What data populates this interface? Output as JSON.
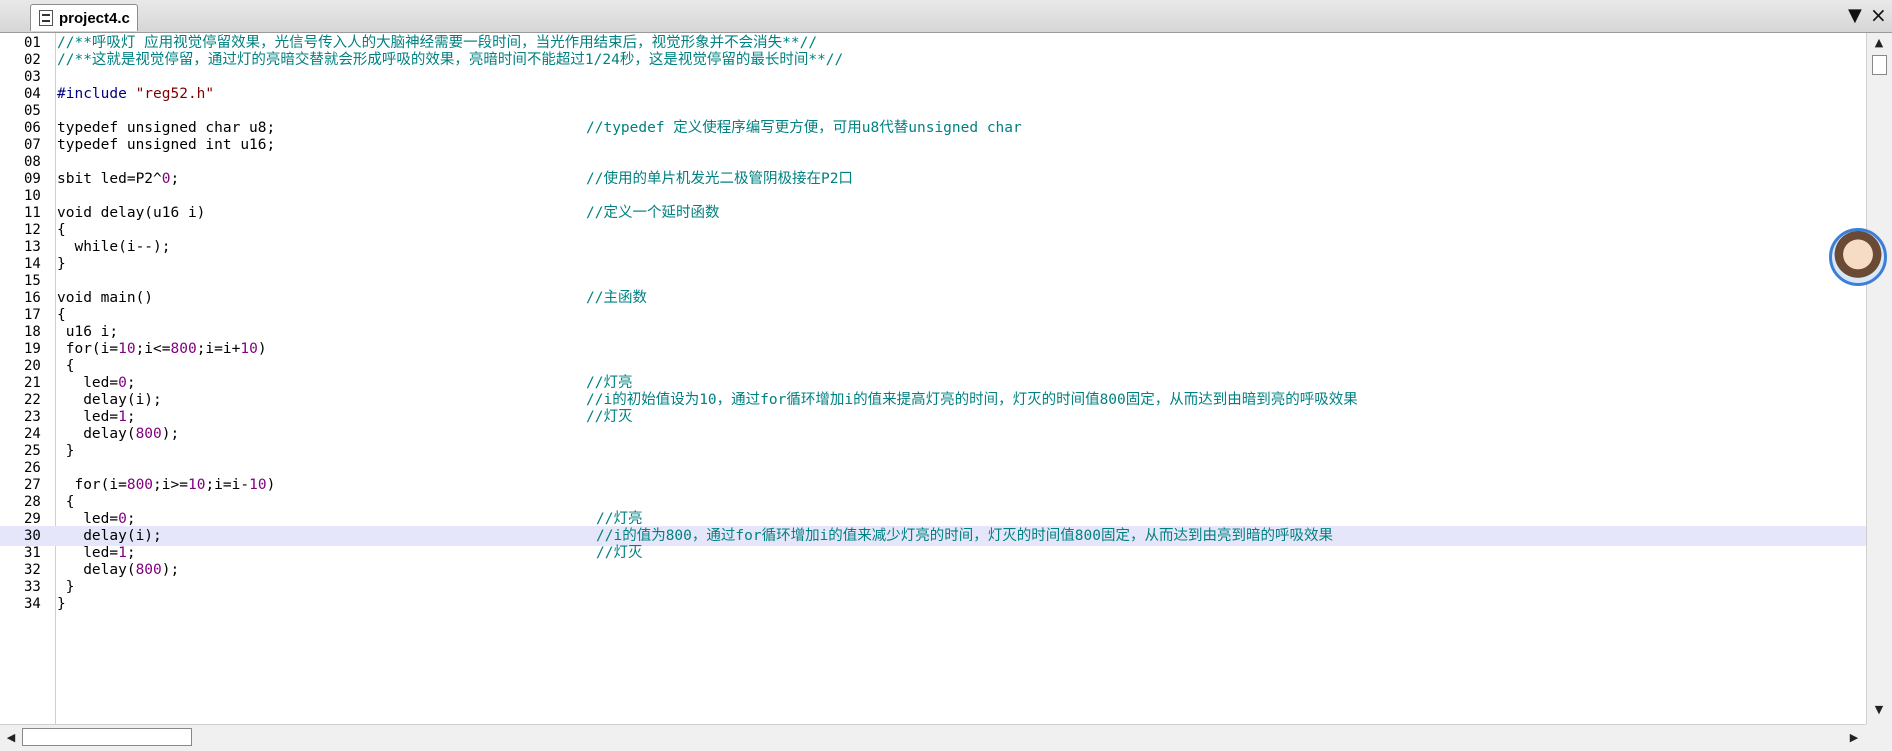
{
  "tab": {
    "filename": "project4.c",
    "dropdown_icon": "chevron-down-icon",
    "close_icon": "close-icon"
  },
  "tabbar_controls": {
    "dropdown_glyph": "▼",
    "close_glyph": "×"
  },
  "scroll_glyphs": {
    "up": "▲",
    "down": "▼",
    "left": "◀",
    "right": "▶"
  },
  "editor": {
    "current_line": 30,
    "lines": [
      {
        "num": "01",
        "code": "",
        "comment": "//**呼吸灯 应用视觉停留效果，光信号传入人的大脑神经需要一段时间，当光作用结束后，视觉形象并不会消失**//",
        "comment_col": 0
      },
      {
        "num": "02",
        "code": "",
        "comment": "//**这就是视觉停留，通过灯的亮暗交替就会形成呼吸的效果，亮暗时间不能超过1/24秒，这是视觉停留的最长时间**//",
        "comment_col": 0
      },
      {
        "num": "03",
        "code": "",
        "comment": ""
      },
      {
        "num": "04",
        "code": "#include \"reg52.h\"",
        "comment": ""
      },
      {
        "num": "05",
        "code": "",
        "comment": ""
      },
      {
        "num": "06",
        "code": "typedef unsigned char u8;",
        "comment": "//typedef 定义使程序编写更方便，可用u8代替unsigned char",
        "comment_col": 1
      },
      {
        "num": "07",
        "code": "typedef unsigned int u16;",
        "comment": ""
      },
      {
        "num": "08",
        "code": "",
        "comment": ""
      },
      {
        "num": "09",
        "code": "sbit led=P2^0;",
        "comment": "//使用的单片机发光二极管阴极接在P2口",
        "comment_col": 1
      },
      {
        "num": "10",
        "code": "",
        "comment": ""
      },
      {
        "num": "11",
        "code": "void delay(u16 i)",
        "comment": "//定义一个延时函数",
        "comment_col": 1
      },
      {
        "num": "12",
        "code": "{",
        "comment": ""
      },
      {
        "num": "13",
        "code": "  while(i--);",
        "comment": ""
      },
      {
        "num": "14",
        "code": "}",
        "comment": ""
      },
      {
        "num": "15",
        "code": "",
        "comment": ""
      },
      {
        "num": "16",
        "code": "void main()",
        "comment": "//主函数",
        "comment_col": 1
      },
      {
        "num": "17",
        "code": "{",
        "comment": ""
      },
      {
        "num": "18",
        "code": " u16 i;",
        "comment": ""
      },
      {
        "num": "19",
        "code": " for(i=10;i<=800;i=i+10)",
        "comment": ""
      },
      {
        "num": "20",
        "code": " {",
        "comment": ""
      },
      {
        "num": "21",
        "code": "   led=0;",
        "comment": "//灯亮",
        "comment_col": 1
      },
      {
        "num": "22",
        "code": "   delay(i);",
        "comment": "//i的初始值设为10，通过for循环增加i的值来提高灯亮的时间，灯灭的时间值800固定，从而达到由暗到亮的呼吸效果",
        "comment_col": 1
      },
      {
        "num": "23",
        "code": "   led=1;",
        "comment": "//灯灭",
        "comment_col": 1
      },
      {
        "num": "24",
        "code": "   delay(800);",
        "comment": ""
      },
      {
        "num": "25",
        "code": " }",
        "comment": ""
      },
      {
        "num": "26",
        "code": "",
        "comment": ""
      },
      {
        "num": "27",
        "code": "  for(i=800;i>=10;i=i-10)",
        "comment": ""
      },
      {
        "num": "28",
        "code": " {",
        "comment": ""
      },
      {
        "num": "29",
        "code": "   led=0;",
        "comment": "//灯亮",
        "comment_col": 2
      },
      {
        "num": "30",
        "code": "   delay(i);",
        "comment": "//i的值为800，通过for循环增加i的值来减少灯亮的时间，灯灭的时间值800固定，从而达到由亮到暗的呼吸效果",
        "comment_col": 2
      },
      {
        "num": "31",
        "code": "   led=1;",
        "comment": "//灯灭",
        "comment_col": 2
      },
      {
        "num": "32",
        "code": "   delay(800);",
        "comment": ""
      },
      {
        "num": "33",
        "code": " }",
        "comment": ""
      },
      {
        "num": "34",
        "code": "}",
        "comment": ""
      }
    ]
  },
  "colors": {
    "comment": "#008080",
    "number": "#800080",
    "string": "#800000",
    "current_line_bg": "#e6e6fa",
    "avatar_border": "#3c7fd6"
  }
}
